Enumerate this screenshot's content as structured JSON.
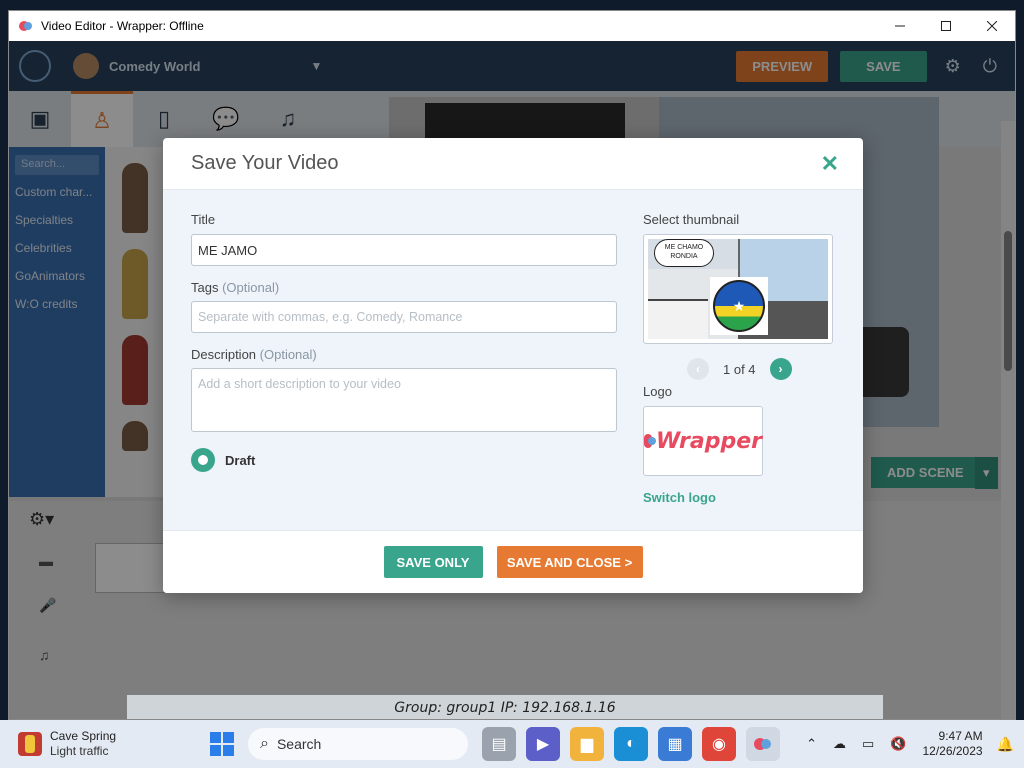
{
  "window": {
    "title": "Video Editor - Wrapper: Offline",
    "min_icon": "minimize-icon",
    "max_icon": "maximize-icon",
    "close_icon": "close-icon"
  },
  "app": {
    "theme_name": "Comedy World",
    "preview_label": "PREVIEW",
    "save_label": "SAVE",
    "left_panel": {
      "search_placeholder": "Search...",
      "categories": [
        "Custom char...",
        "Specialties",
        "Celebrities",
        "GoAnimators",
        "W:O credits"
      ]
    },
    "add_scene_label": "ADD SCENE",
    "status_line": "Group: group1   IP: 192.168.1.16"
  },
  "modal": {
    "title": "Save Your Video",
    "title_label": "Title",
    "title_value": "ME JAMO",
    "tags_label": "Tags",
    "tags_optional": "(Optional)",
    "tags_placeholder": "Separate with commas, e.g. Comedy, Romance",
    "description_label": "Description",
    "description_optional": "(Optional)",
    "description_placeholder": "Add a short description to your video",
    "draft_label": "Draft",
    "select_thumbnail_label": "Select thumbnail",
    "thumbnail_bubble_text": "ME CHAMO RONDIA",
    "pager_text": "1 of 4",
    "logo_label": "Logo",
    "logo_text": "Wrapper",
    "switch_logo_label": "Switch logo",
    "save_only_label": "SAVE ONLY",
    "save_and_close_label": "SAVE AND CLOSE >"
  },
  "taskbar": {
    "weather_title": "Cave Spring",
    "weather_sub": "Light traffic",
    "search_label": "Search",
    "time": "9:47 AM",
    "date": "12/26/2023"
  },
  "colors": {
    "accent_green": "#3aa58d",
    "accent_orange": "#e67a32",
    "topbar": "#27415e"
  }
}
